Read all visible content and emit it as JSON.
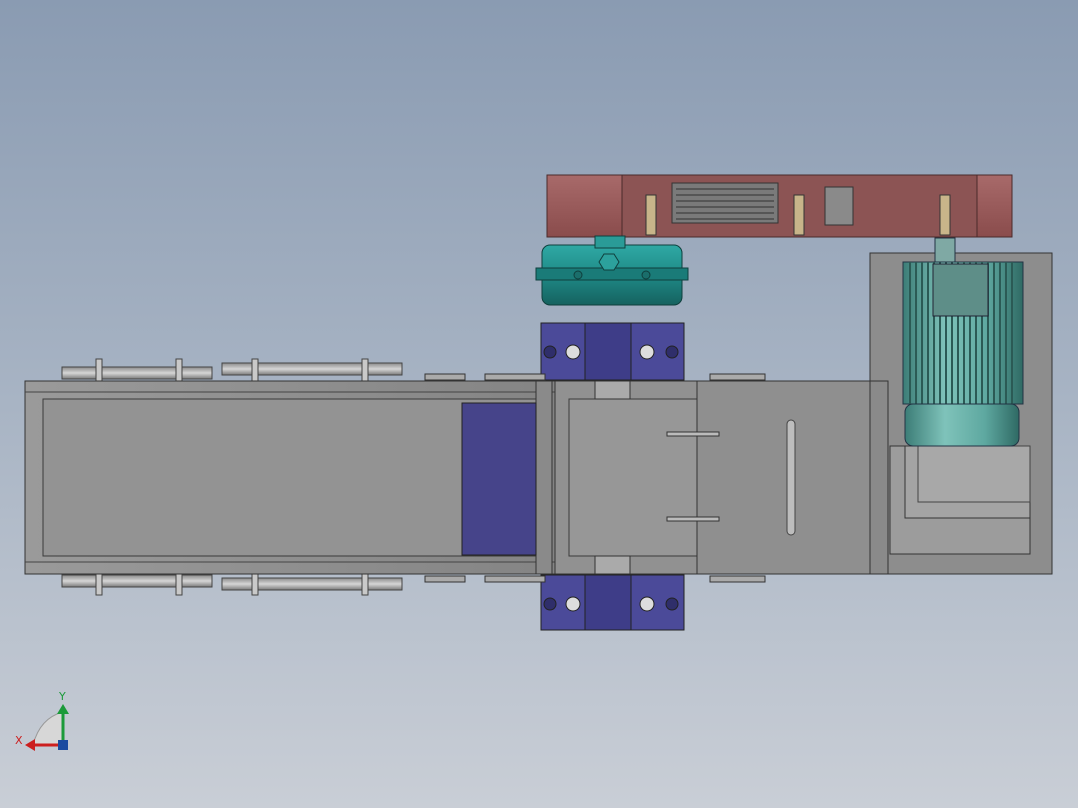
{
  "viewport": {
    "background_top": "#8a9bb2",
    "background_bottom": "#c9ced6"
  },
  "triad": {
    "x_label": "X",
    "y_label": "Y",
    "x_color": "#cc1f1f",
    "y_color": "#1b9a3a"
  },
  "colors": {
    "frame_gray": "#8c8c8c",
    "frame_dark": "#5a5a5a",
    "roller": "#b5b5b5",
    "belt_blue": "#46448a",
    "bearing_blue": "#4b4a99",
    "gearbox_teal": "#1f8a87",
    "motor_teal": "#5ea8a0",
    "coupling_red": "#9a5a5a",
    "hopper_gray": "#8f8f8f"
  },
  "parts": [
    "conveyor-frame",
    "idler-rollers",
    "belt-section",
    "bearing-housings",
    "gearbox",
    "coupling-guard",
    "electric-motor",
    "motor-base",
    "discharge-hopper"
  ]
}
